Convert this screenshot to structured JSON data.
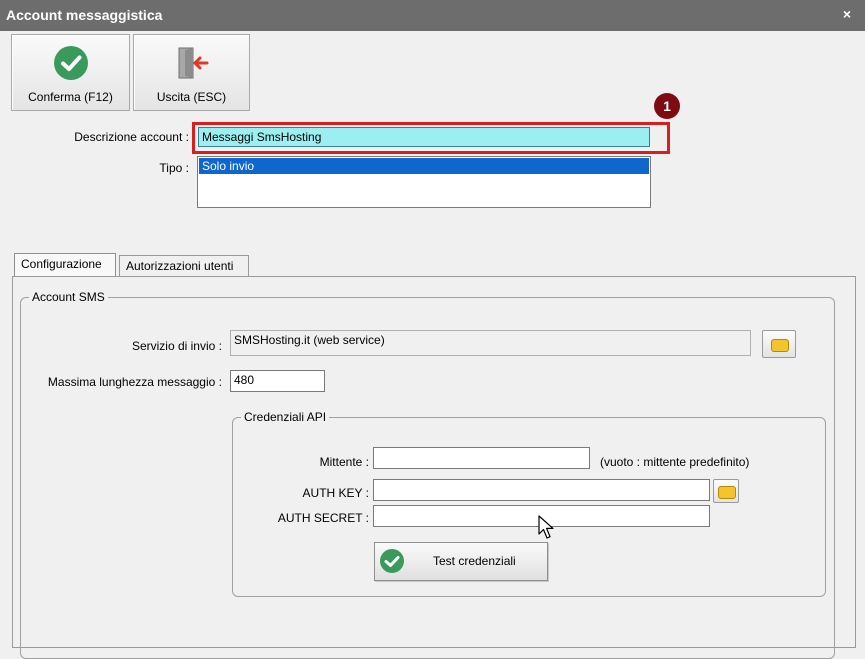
{
  "window": {
    "title": "Account messaggistica",
    "close_glyph": "×"
  },
  "toolbar": {
    "confirm_label": "Conferma (F12)",
    "exit_label": "Uscita (ESC)"
  },
  "form": {
    "descrizione_label": "Descrizione account :",
    "descrizione_value": "Messaggi SmsHosting",
    "tipo_label": "Tipo :",
    "tipo_selected": "Solo invio",
    "annotation_number": "1"
  },
  "tabs": [
    {
      "label": "Configurazione",
      "active": true
    },
    {
      "label": "Autorizzazioni utenti",
      "active": false
    }
  ],
  "account_sms": {
    "legend": "Account SMS",
    "servizio_label": "Servizio di invio :",
    "servizio_value": "SMSHosting.it (web service)",
    "lunghezza_label": "Massima lunghezza messaggio :",
    "lunghezza_value": "480"
  },
  "credenziali": {
    "legend": "Credenziali API",
    "mittente_label": "Mittente :",
    "mittente_value": "",
    "mittente_hint": "(vuoto : mittente predefinito)",
    "auth_key_label": "AUTH KEY :",
    "auth_key_value": "",
    "auth_secret_label": "AUTH SECRET :",
    "auth_secret_value": "",
    "test_label": "Test credenziali"
  },
  "colors": {
    "titlebar": "#6d6d6d",
    "highlight": "#d81e1e",
    "badge": "#7e0b12",
    "selected_field": "#9beff0",
    "list_selection": "#0f66cc",
    "check_green": "#3a9a5b"
  }
}
